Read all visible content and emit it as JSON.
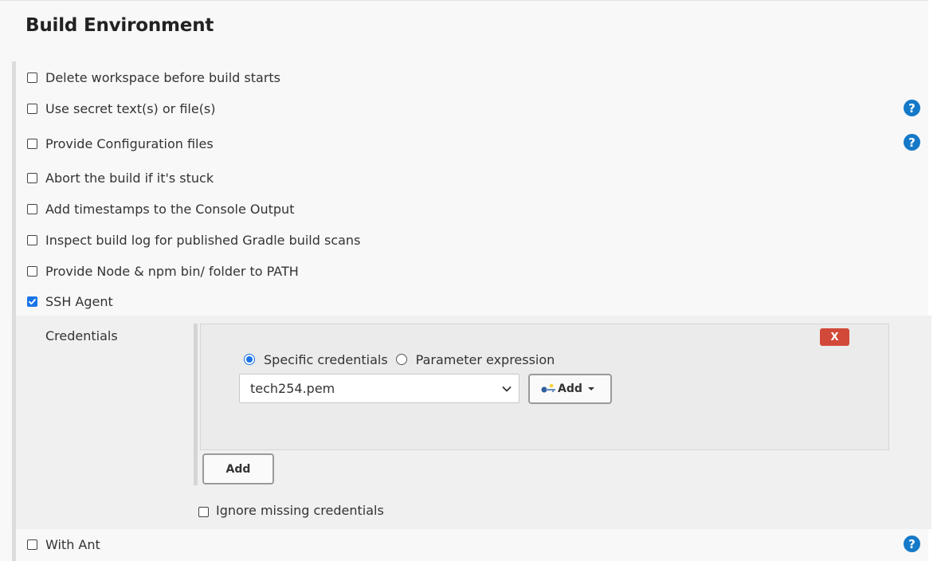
{
  "section": {
    "title": "Build Environment"
  },
  "options": [
    {
      "label": "Delete workspace before build starts",
      "checked": false,
      "help": false
    },
    {
      "label": "Use secret text(s) or file(s)",
      "checked": false,
      "help": true
    },
    {
      "label": "Provide Configuration files",
      "checked": false,
      "help": true
    },
    {
      "label": "Abort the build if it's stuck",
      "checked": false,
      "help": false
    },
    {
      "label": "Add timestamps to the Console Output",
      "checked": false,
      "help": false
    },
    {
      "label": "Inspect build log for published Gradle build scans",
      "checked": false,
      "help": false
    },
    {
      "label": "Provide Node & npm bin/ folder to PATH",
      "checked": false,
      "help": false
    },
    {
      "label": "SSH Agent",
      "checked": true,
      "help": false
    },
    {
      "label": "With Ant",
      "checked": false,
      "help": true
    }
  ],
  "help_glyph": "?",
  "ssh_agent": {
    "credentials_label": "Credentials",
    "delete_label": "X",
    "radio_specific": "Specific credentials",
    "radio_parameter": "Parameter expression",
    "selected_radio": "specific",
    "selected_credential": "tech254.pem",
    "add_dropdown_label": "Add",
    "add_button_label": "Add",
    "ignore_missing_label": "Ignore missing credentials",
    "ignore_missing_checked": false
  },
  "colors": {
    "accent": "#1a73e8",
    "help_icon": "#1479c8",
    "delete_button": "#d24939"
  }
}
